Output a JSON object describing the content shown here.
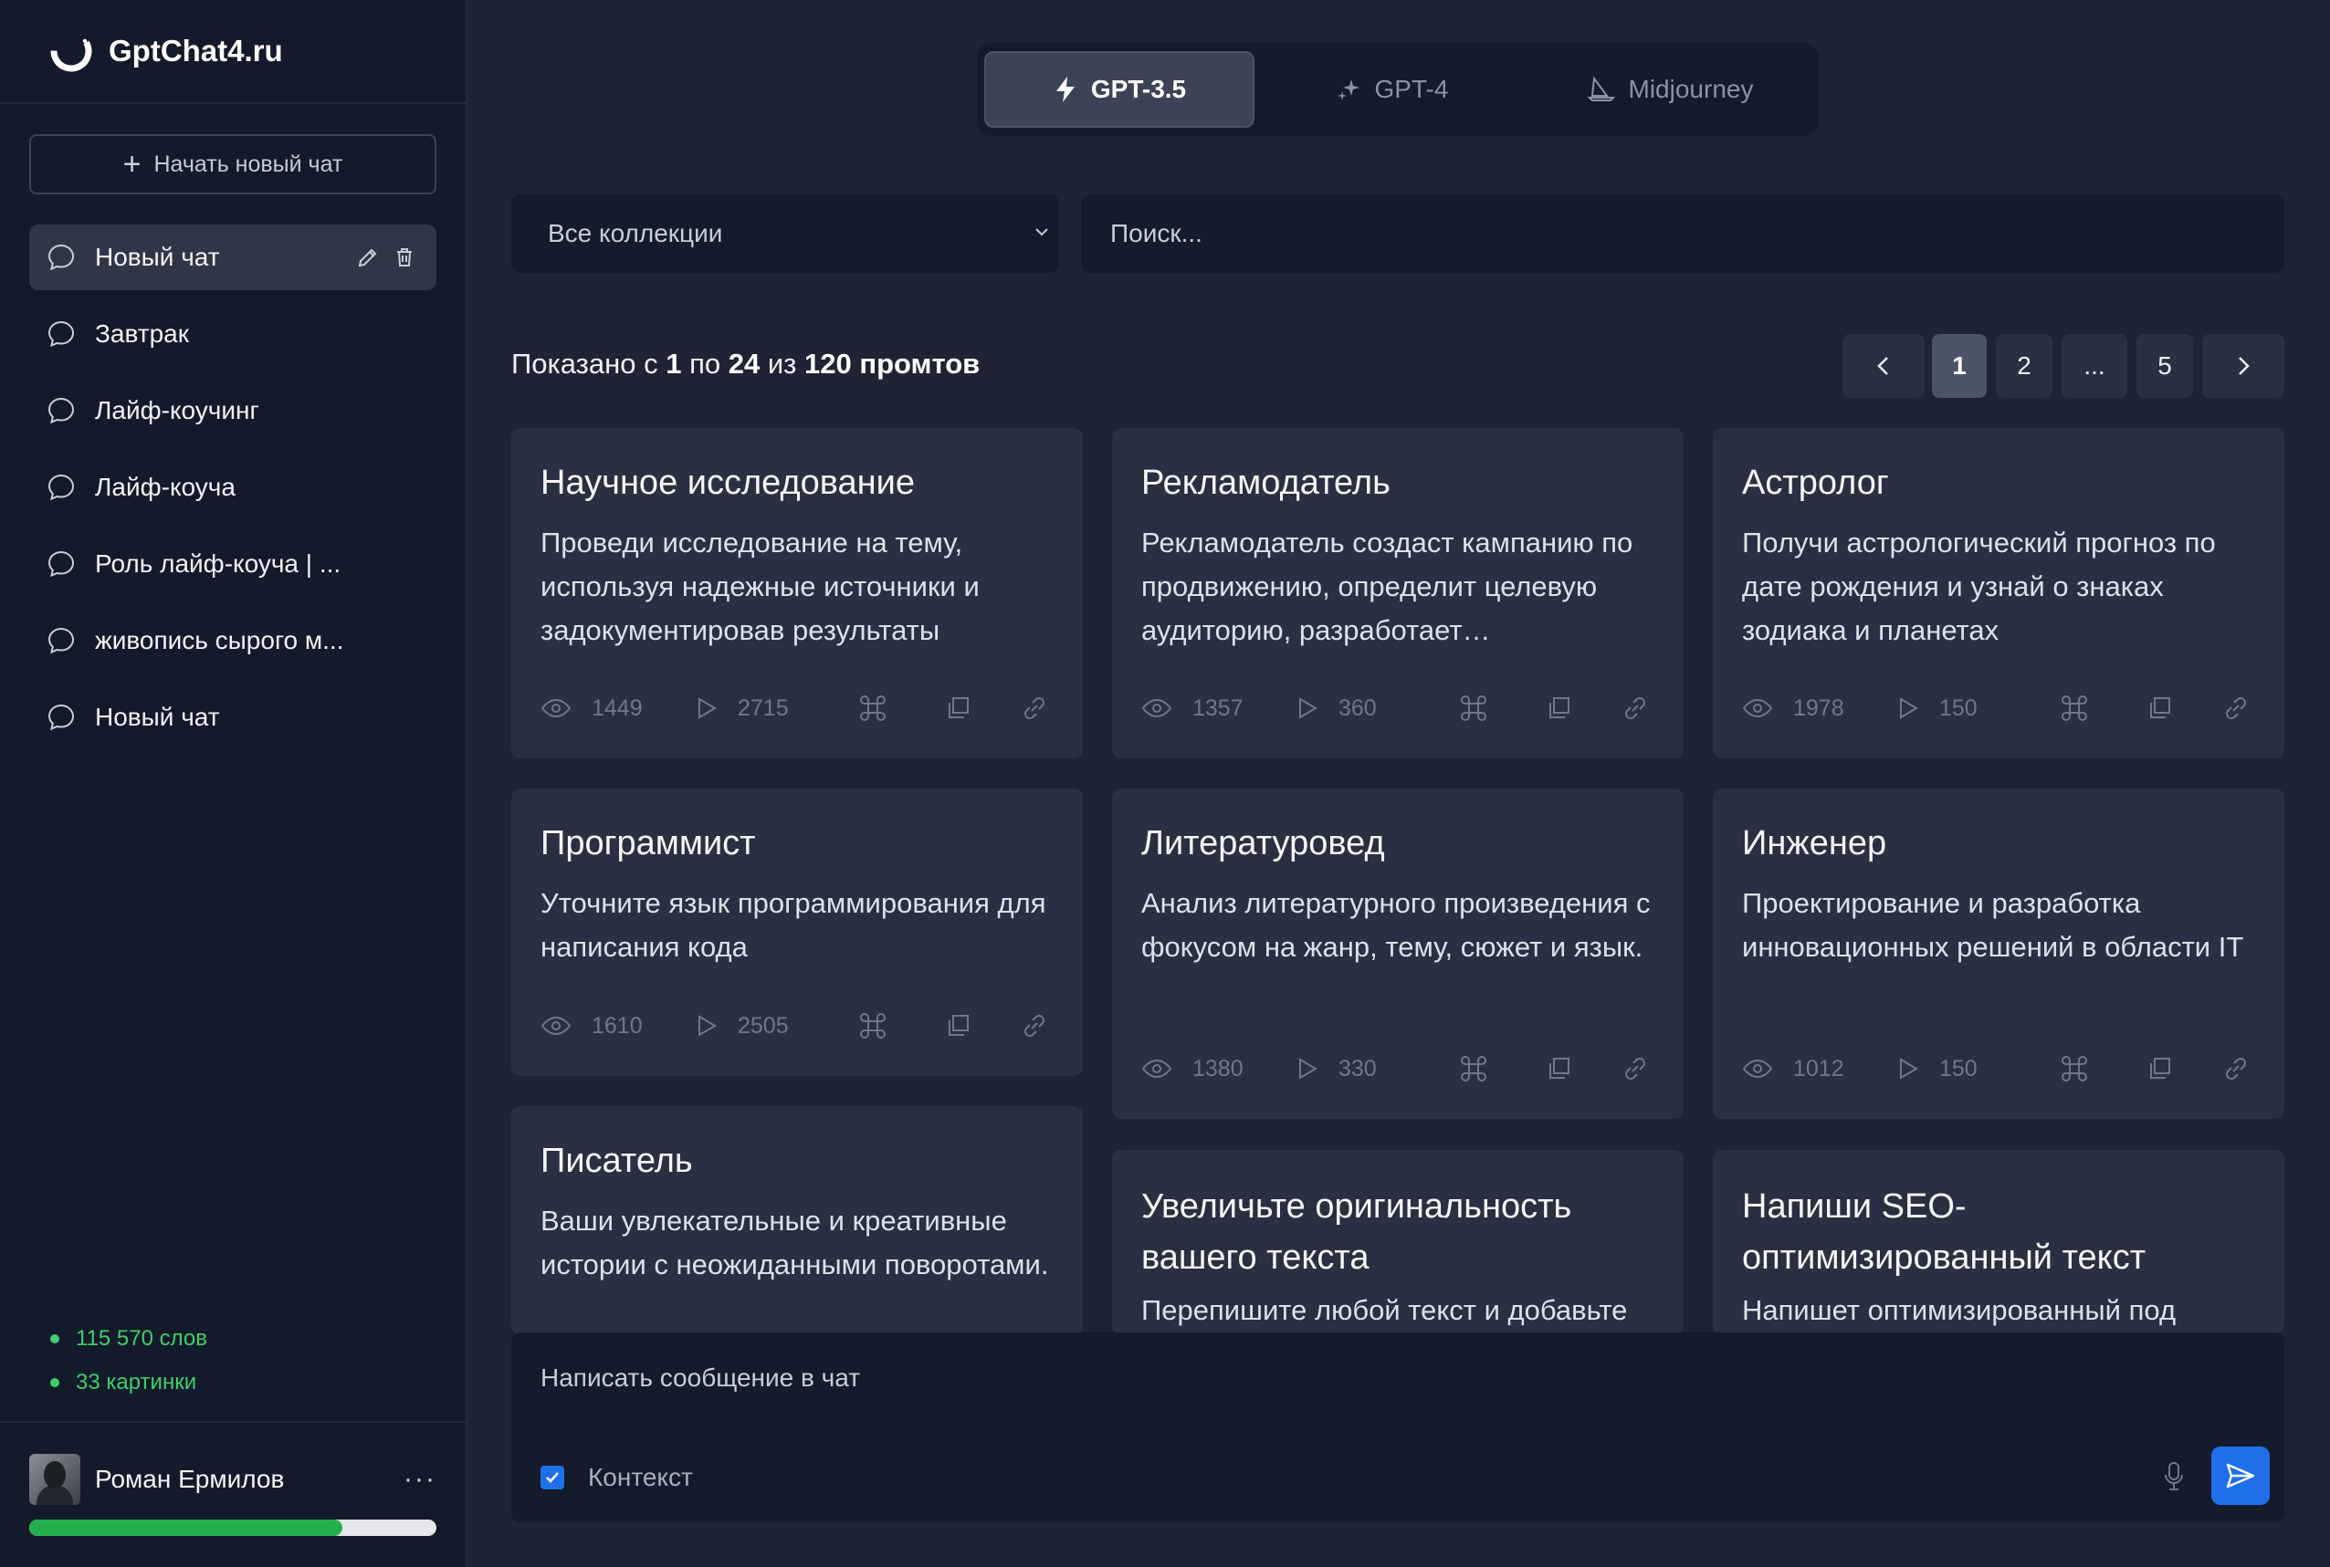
{
  "brand": {
    "name": "GptChat4.ru"
  },
  "sidebar": {
    "new_chat_label": "Начать новый чат",
    "chats": [
      {
        "label": "Новый чат",
        "active": true
      },
      {
        "label": "Завтрак"
      },
      {
        "label": "Лайф-коучинг"
      },
      {
        "label": "Лайф-коуча"
      },
      {
        "label": "Роль лайф-коуча | ..."
      },
      {
        "label": "живопись сырого м..."
      },
      {
        "label": "Новый чат"
      }
    ],
    "stats": {
      "words": "115 570 слов",
      "images": "33 картинки"
    },
    "user": {
      "name": "Роман Ермилов",
      "menu": "···",
      "quota_fraction": 0.77
    }
  },
  "models": [
    {
      "label": "GPT-3.5",
      "icon": "bolt-icon",
      "active": true
    },
    {
      "label": "GPT-4",
      "icon": "sparkles-icon"
    },
    {
      "label": "Midjourney",
      "icon": "sailboat-icon"
    }
  ],
  "filters": {
    "collection": "Все коллекции",
    "search_placeholder": "Поиск..."
  },
  "summary": {
    "prefix": "Показано с",
    "from": "1",
    "mid": "по",
    "to": "24",
    "of": "из",
    "total": "120 промтов"
  },
  "pagination": {
    "pages": [
      "1",
      "2",
      "...",
      "5"
    ],
    "current": "1"
  },
  "prompts": [
    {
      "title": "Научное исследование",
      "desc": "Проведи исследование на тему, используя надежные источники и задокументировав результаты",
      "views": "1449",
      "runs": "2715"
    },
    {
      "title": "Рекламодатель",
      "desc": "Рекламодатель создаст кампанию по продвижению, определит целевую аудиторию, разработает…",
      "views": "1357",
      "runs": "360"
    },
    {
      "title": "Астролог",
      "desc": "Получи астрологический прогноз по дате рождения и узнай о знаках зодиака и планетах",
      "views": "1978",
      "runs": "150"
    },
    {
      "title": "Программист",
      "desc": "Уточните язык программирования для написания кода",
      "views": "1610",
      "runs": "2505"
    },
    {
      "title": "Литературовед",
      "desc": "Анализ литературного произведения с фокусом на жанр, тему, сюжет и язык.",
      "views": "1380",
      "runs": "330"
    },
    {
      "title": "Инженер",
      "desc": "Проектирование и разработка инновационных решений в области IT",
      "views": "1012",
      "runs": "150"
    },
    {
      "title": "Писатель",
      "desc": "Ваши увлекательные и креативные истории с неожиданными поворотами."
    },
    {
      "title": "Увеличьте оригинальность вашего текста",
      "desc": "Перепишите любой текст и добавьте"
    },
    {
      "title": "Напиши SEO-оптимизированный текст",
      "desc": "Напишет оптимизированный под"
    }
  ],
  "composer": {
    "placeholder": "Написать сообщение в чат",
    "context_label": "Контекст",
    "context_checked": true
  },
  "colors": {
    "accent": "#1f6feb",
    "success": "#3fcf6b",
    "card": "#283041",
    "bg": "#1e2433",
    "sidebar": "#131a2a"
  }
}
